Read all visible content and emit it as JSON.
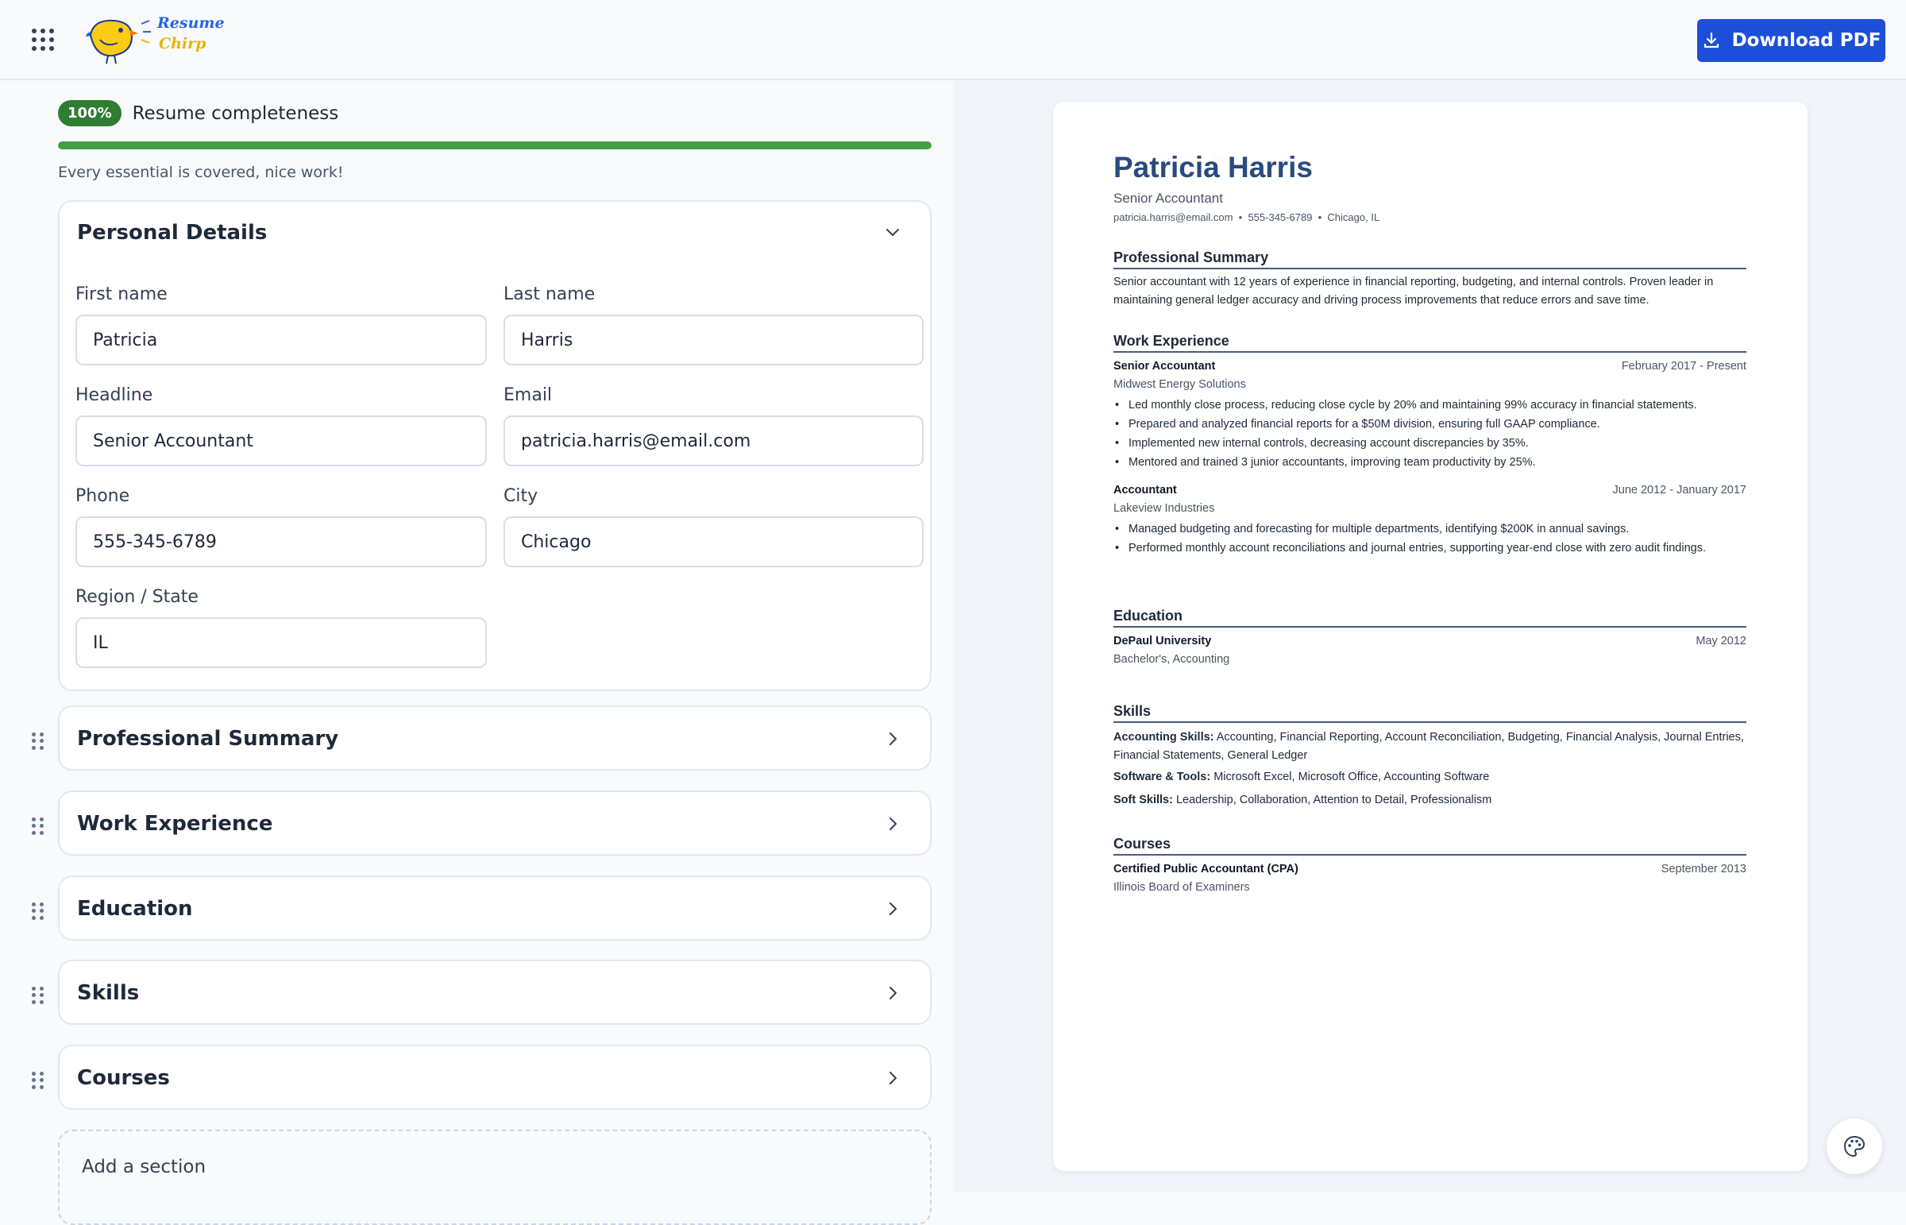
{
  "app": {
    "logo_top": "Resume",
    "logo_bottom": "Chirp",
    "download_label": "Download PDF"
  },
  "progress": {
    "percent_label": "100%",
    "percent": 100,
    "title": "Resume completeness",
    "note": "Every essential is covered, nice work!"
  },
  "personal": {
    "title": "Personal Details",
    "first_name_label": "First name",
    "first_name": "Patricia",
    "last_name_label": "Last name",
    "last_name": "Harris",
    "headline_label": "Headline",
    "headline": "Senior Accountant",
    "email_label": "Email",
    "email": "patricia.harris@email.com",
    "phone_label": "Phone",
    "phone": "555-345-6789",
    "city_label": "City",
    "city": "Chicago",
    "region_label": "Region / State",
    "region": "IL"
  },
  "sections": [
    "Professional Summary",
    "Work Experience",
    "Education",
    "Skills",
    "Courses"
  ],
  "add_section_label": "Add a section",
  "resume": {
    "name": "Patricia Harris",
    "headline": "Senior Accountant",
    "contact": "patricia.harris@email.com  •  555-345-6789  •  Chicago, IL",
    "summary_title": "Professional Summary",
    "summary": "Senior accountant with 12 years of experience in financial reporting, budgeting, and internal controls. Proven leader in maintaining general ledger accuracy and driving process improvements that reduce errors and save time.",
    "work_title": "Work Experience",
    "jobs": [
      {
        "role": "Senior Accountant",
        "dates": "February 2017 - Present",
        "company": "Midwest Energy Solutions",
        "bullets": [
          "Led monthly close process, reducing close cycle by 20% and maintaining 99% accuracy in financial statements.",
          "Prepared and analyzed financial reports for a $50M division, ensuring full GAAP compliance.",
          "Implemented new internal controls, decreasing account discrepancies by 35%.",
          "Mentored and trained 3 junior accountants, improving team productivity by 25%."
        ]
      },
      {
        "role": "Accountant",
        "dates": "June 2012 - January 2017",
        "company": "Lakeview Industries",
        "bullets": [
          "Managed budgeting and forecasting for multiple departments, identifying $200K in annual savings.",
          "Performed monthly account reconciliations and journal entries, supporting year-end close with zero audit findings."
        ]
      }
    ],
    "education_title": "Education",
    "school": "DePaul University",
    "school_date": "May 2012",
    "degree": "Bachelor's, Accounting",
    "skills_title": "Skills",
    "skills": [
      {
        "label": "Accounting Skills:",
        "value": "Accounting, Financial Reporting, Account Reconciliation, Budgeting, Financial Analysis, Jour­nal Entries, Financial Statements, General Ledger"
      },
      {
        "label": "Software & Tools:",
        "value": "Microsoft Excel, Microsoft Office, Accounting Software"
      },
      {
        "label": "Soft Skills:",
        "value": "Leadership, Collaboration, Attention to Detail, Professionalism"
      }
    ],
    "courses_title": "Courses",
    "course": "Certified Public Accountant (CPA)",
    "course_date": "September 2013",
    "course_org": "Illinois Board of Examiners"
  },
  "icons": {
    "apps": "apps-grid-icon",
    "download": "download-icon",
    "chevron_down": "chevron-down-icon",
    "chevron_right": "chevron-right-icon",
    "drag": "drag-handle-icon",
    "palette": "palette-icon"
  },
  "colors": {
    "accent": "#1d4ed8",
    "success": "#2e7d32",
    "progress": "#43a047",
    "resume_name": "#2b4a7e"
  }
}
